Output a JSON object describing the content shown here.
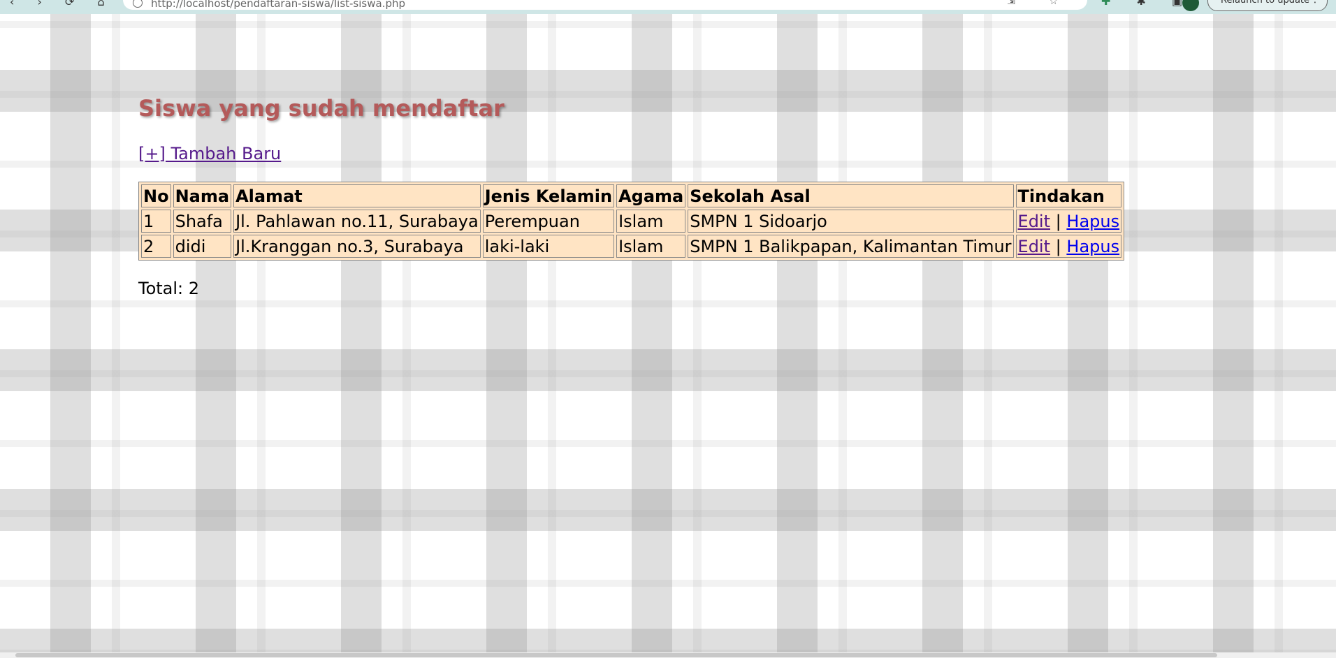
{
  "browser": {
    "nav_icons": "‹ › ⟳ ⌂",
    "url": "http://localhost/pendaftaran-siswa/list-siswa.php",
    "address_right_icons": "⇲ ☆",
    "relaunch_label": "Relaunch to update",
    "kebab": "⋮"
  },
  "page": {
    "heading": "Siswa yang sudah mendaftar",
    "add_link": "[+] Tambah Baru",
    "total_label": "Total: 2"
  },
  "table": {
    "headers": [
      "No",
      "Nama",
      "Alamat",
      "Jenis Kelamin",
      "Agama",
      "Sekolah Asal",
      "Tindakan"
    ],
    "rows": [
      {
        "no": "1",
        "nama": "Shafa",
        "alamat": "Jl. Pahlawan no.11, Surabaya",
        "jenis_kelamin": "Perempuan",
        "agama": "Islam",
        "sekolah_asal": "SMPN 1 Sidoarjo",
        "edit": "Edit",
        "separator": "|",
        "hapus": "Hapus"
      },
      {
        "no": "2",
        "nama": "didi",
        "alamat": "Jl.Kranggan no.3, Surabaya",
        "jenis_kelamin": "laki-laki",
        "agama": "Islam",
        "sekolah_asal": "SMPN 1 Balikpapan, Kalimantan Timur",
        "edit": "Edit",
        "separator": "|",
        "hapus": "Hapus"
      }
    ]
  },
  "colors": {
    "heading": "#b45a5a",
    "table_bg": "#ffe4c4",
    "visited_link": "#551a8b",
    "link": "#0000ee"
  }
}
